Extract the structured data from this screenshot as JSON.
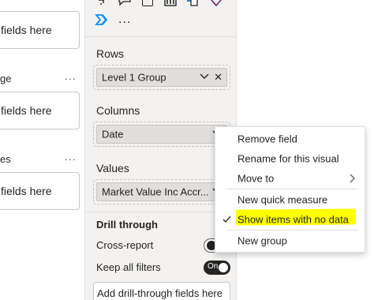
{
  "left_pane": {
    "box1_text": "fields here",
    "label2": "ge",
    "box2_text": "fields here",
    "label3": "es",
    "box3_text": "fields here",
    "more": "..."
  },
  "fields_pane": {
    "viz_more": "...",
    "rows": {
      "label": "Rows",
      "field": "Level 1 Group"
    },
    "columns": {
      "label": "Columns",
      "field": "Date"
    },
    "values": {
      "label": "Values",
      "field": "Market Value Inc Accr..."
    },
    "drill_through": {
      "label": "Drill through",
      "cross_report": "Cross-report",
      "keep_all_filters": "Keep all filters",
      "keep_all_filters_state": "On",
      "add_fields": "Add drill-through fields here"
    }
  },
  "context_menu": {
    "items": [
      {
        "label": "Remove field"
      },
      {
        "label": "Rename for this visual"
      },
      {
        "label": "Move to",
        "submenu": true
      },
      {
        "label": "New quick measure"
      },
      {
        "label": "Show items with no data",
        "checked": true
      },
      {
        "label": "New group"
      }
    ]
  },
  "colors": {
    "accent": "#118dff",
    "highlight": "#ffff00",
    "pane_bg": "#f3f2f1"
  }
}
